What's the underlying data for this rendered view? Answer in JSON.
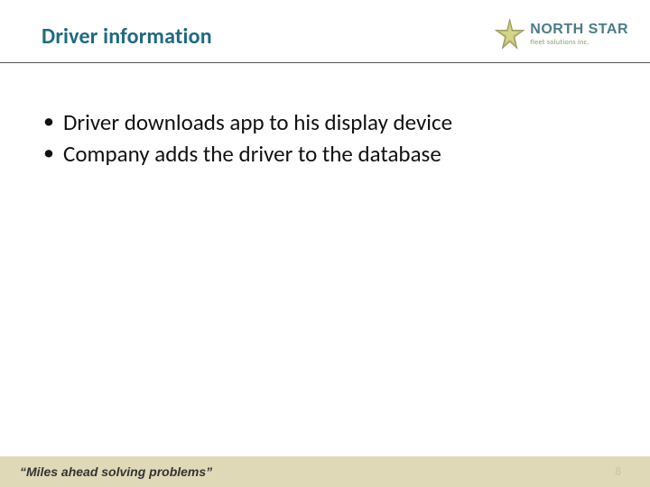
{
  "header": {
    "title": "Driver information",
    "logo": {
      "main": "NORTH STAR",
      "sub": "fleet solutions inc."
    }
  },
  "content": {
    "bullets": [
      "Driver downloads app to his display device",
      "Company adds the driver to the database"
    ]
  },
  "footer": {
    "tagline": "“Miles ahead solving problems”",
    "page": "8"
  }
}
